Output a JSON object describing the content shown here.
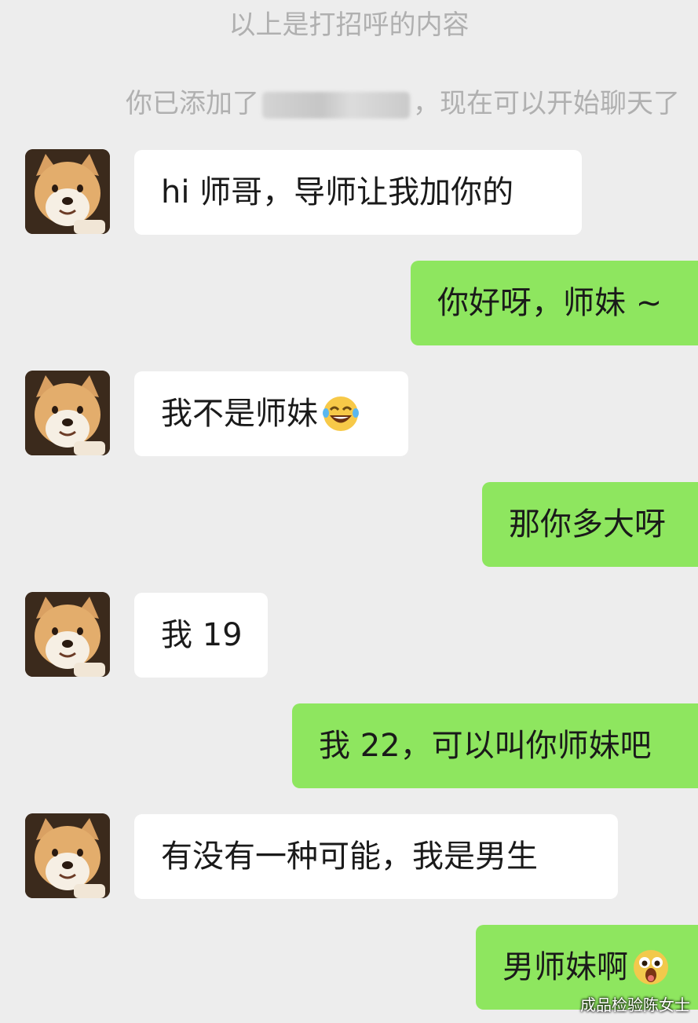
{
  "system": {
    "greeting_note": "以上是打招呼的内容",
    "added_prefix": "你已添加了",
    "added_suffix": "，现在可以开始聊天了"
  },
  "messages": [
    {
      "side": "in",
      "text": "hi 师哥，导师让我加你的"
    },
    {
      "side": "out",
      "text": "你好呀，师妹 ~"
    },
    {
      "side": "in",
      "text": "我不是师妹",
      "emoji": "laughing-tears-emoji"
    },
    {
      "side": "out",
      "text": "那你多大呀"
    },
    {
      "side": "in",
      "text": "我 19"
    },
    {
      "side": "out",
      "text": "我 22，可以叫你师妹吧"
    },
    {
      "side": "in",
      "text": "有没有一种可能，我是男生"
    },
    {
      "side": "out",
      "text": "男师妹啊",
      "emoji": "shocked-face-emoji"
    }
  ],
  "avatar": {
    "icon": "shiba-dog-avatar"
  },
  "watermark": "成品检验陈女士",
  "colors": {
    "background": "#ededed",
    "incoming_bubble": "#ffffff",
    "outgoing_bubble": "#8ee65f"
  }
}
